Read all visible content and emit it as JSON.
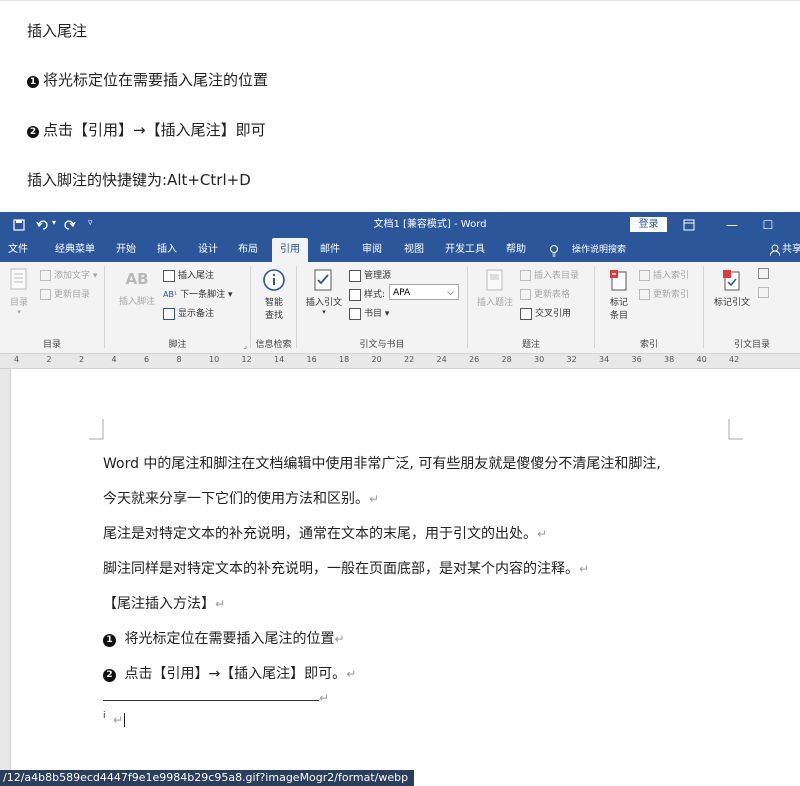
{
  "article": {
    "heading": "插入尾注",
    "step1": "将光标定位在需要插入尾注的位置",
    "step1_num": "1",
    "step2": "点击【引用】→【插入尾注】即可",
    "step2_num": "2",
    "shortcut": "插入脚注的快捷键为:Alt+Ctrl+D"
  },
  "titlebar": {
    "doc_title": "文档1 [兼容模式] - Word",
    "login": "登录"
  },
  "tabs": [
    "文件",
    "经典菜单",
    "开始",
    "插入",
    "设计",
    "布局",
    "引用",
    "邮件",
    "审阅",
    "视图",
    "开发工具",
    "帮助",
    "操作说明搜索",
    "共享"
  ],
  "ribbon": {
    "toc": {
      "big": "目录",
      "add_text": "添加文字",
      "update": "更新目录",
      "label": "目录"
    },
    "footnote": {
      "insert_footnote": "插入脚注",
      "insert_endnote": "插入尾注",
      "next_footnote": "下一条脚注",
      "show_notes": "显示备注",
      "label": "脚注",
      "ab": "AB"
    },
    "research": {
      "smart_lookup_1": "智能",
      "smart_lookup_2": "查找",
      "label": "信息检索"
    },
    "citation": {
      "insert_citation": "插入引文",
      "manage_sources": "管理源",
      "style_label": "样式:",
      "style_value": "APA",
      "bibliography": "书目",
      "label": "引文与书目"
    },
    "captions": {
      "insert_caption": "插入题注",
      "insert_tof": "插入表目录",
      "update_table": "更新表格",
      "cross_ref": "交叉引用",
      "label": "题注"
    },
    "index": {
      "mark_entry_1": "标记",
      "mark_entry_2": "条目",
      "insert_index": "插入索引",
      "update_index": "更新索引",
      "label": "索引"
    },
    "toa": {
      "mark_citation": "标记引文",
      "label": "引文目录"
    }
  },
  "ruler": {
    "numbers": [
      "4",
      "2",
      "2",
      "4",
      "6",
      "8",
      "10",
      "12",
      "14",
      "16",
      "18",
      "20",
      "22",
      "24",
      "26",
      "28",
      "30",
      "32",
      "34",
      "36",
      "38",
      "40",
      "42"
    ]
  },
  "document": {
    "p1": "Word 中的尾注和脚注在文档编辑中使用非常广泛, 可有些朋友就是傻傻分不清尾注和脚注,",
    "p2": "今天就来分享一下它们的使用方法和区别。",
    "p3": "尾注是对特定文本的补充说明，通常在文本的末尾，用于引文的出处。",
    "p4": "脚注同样是对特定文本的补充说明，一般在页面底部，是对某个内容的注释。",
    "p5": "【尾注插入方法】",
    "p6": "将光标定位在需要插入尾注的位置",
    "p6_num": "1",
    "p7": "点击【引用】→【插入尾注】即可。",
    "p7_num": "2",
    "endnote_mark": "i",
    "para_mark": "↵"
  },
  "statusbar": {
    "url": "/12/a4b8b589ecd4447f9e1e9984b29c95a8.gif?imageMogr2/format/webp"
  },
  "colors": {
    "word_blue": "#2b579a",
    "ribbon_bg": "#f3f3f3",
    "status_bg": "#2b3e5c"
  }
}
